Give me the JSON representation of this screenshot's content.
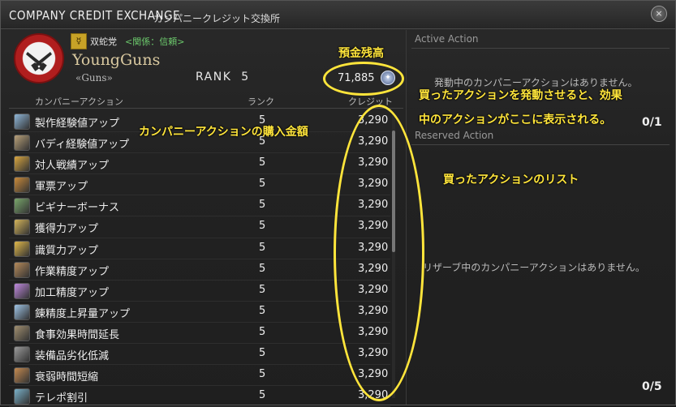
{
  "window": {
    "title": "COMPANY CREDIT EXCHANGE",
    "subtitle": "カンパニークレジット交換所",
    "close_glyph": "×"
  },
  "company": {
    "grand_company": "双蛇党",
    "relation": "<関係：信頼>",
    "name": "YoungGuns",
    "tag": "«Guns»",
    "rank_label": "RANK",
    "rank_value": "5",
    "credits": "71,885"
  },
  "columns": {
    "name": "カンパニーアクション",
    "rank": "ランク",
    "credit": "クレジット"
  },
  "actions": [
    {
      "name": "製作経験値アップ",
      "rank": "5",
      "credit": "3,290",
      "icon_color": "#8fb7d9"
    },
    {
      "name": "バディ経験値アップ",
      "rank": "5",
      "credit": "3,290",
      "icon_color": "#b8a07a"
    },
    {
      "name": "対人戦績アップ",
      "rank": "5",
      "credit": "3,290",
      "icon_color": "#d9a640"
    },
    {
      "name": "軍票アップ",
      "rank": "5",
      "credit": "3,290",
      "icon_color": "#c98a3a"
    },
    {
      "name": "ビギナーボーナス",
      "rank": "5",
      "credit": "3,290",
      "icon_color": "#7aa66b"
    },
    {
      "name": "獲得力アップ",
      "rank": "5",
      "credit": "3,290",
      "icon_color": "#d4b45a"
    },
    {
      "name": "識質力アップ",
      "rank": "5",
      "credit": "3,290",
      "icon_color": "#e0b84a"
    },
    {
      "name": "作業精度アップ",
      "rank": "5",
      "credit": "3,290",
      "icon_color": "#b58a5a"
    },
    {
      "name": "加工精度アップ",
      "rank": "5",
      "credit": "3,290",
      "icon_color": "#c08adf"
    },
    {
      "name": "錬精度上昇量アップ",
      "rank": "5",
      "credit": "3,290",
      "icon_color": "#9fc4e6"
    },
    {
      "name": "食事効果時間延長",
      "rank": "5",
      "credit": "3,290",
      "icon_color": "#a08f70"
    },
    {
      "name": "装備品劣化低減",
      "rank": "5",
      "credit": "3,290",
      "icon_color": "#9a9a9a"
    },
    {
      "name": "衰弱時間短縮",
      "rank": "5",
      "credit": "3,290",
      "icon_color": "#c48a50"
    },
    {
      "name": "テレポ割引",
      "rank": "5",
      "credit": "3,290",
      "icon_color": "#7ab0c8"
    }
  ],
  "active": {
    "title": "Active Action",
    "empty": "発動中のカンパニーアクションはありません。",
    "count": "0/1"
  },
  "reserved": {
    "title": "Reserved Action",
    "empty": "リザーブ中のカンパニーアクションはありません。",
    "count": "0/5"
  },
  "annotations": {
    "balance": "預金残高",
    "activate_line1": "買ったアクションを発動させると、効果",
    "activate_line2": "中のアクションがここに表示される。",
    "purchase_price": "カンパニーアクションの購入金額",
    "bought_list": "買ったアクションのリスト",
    "color": "#ffe53b"
  }
}
